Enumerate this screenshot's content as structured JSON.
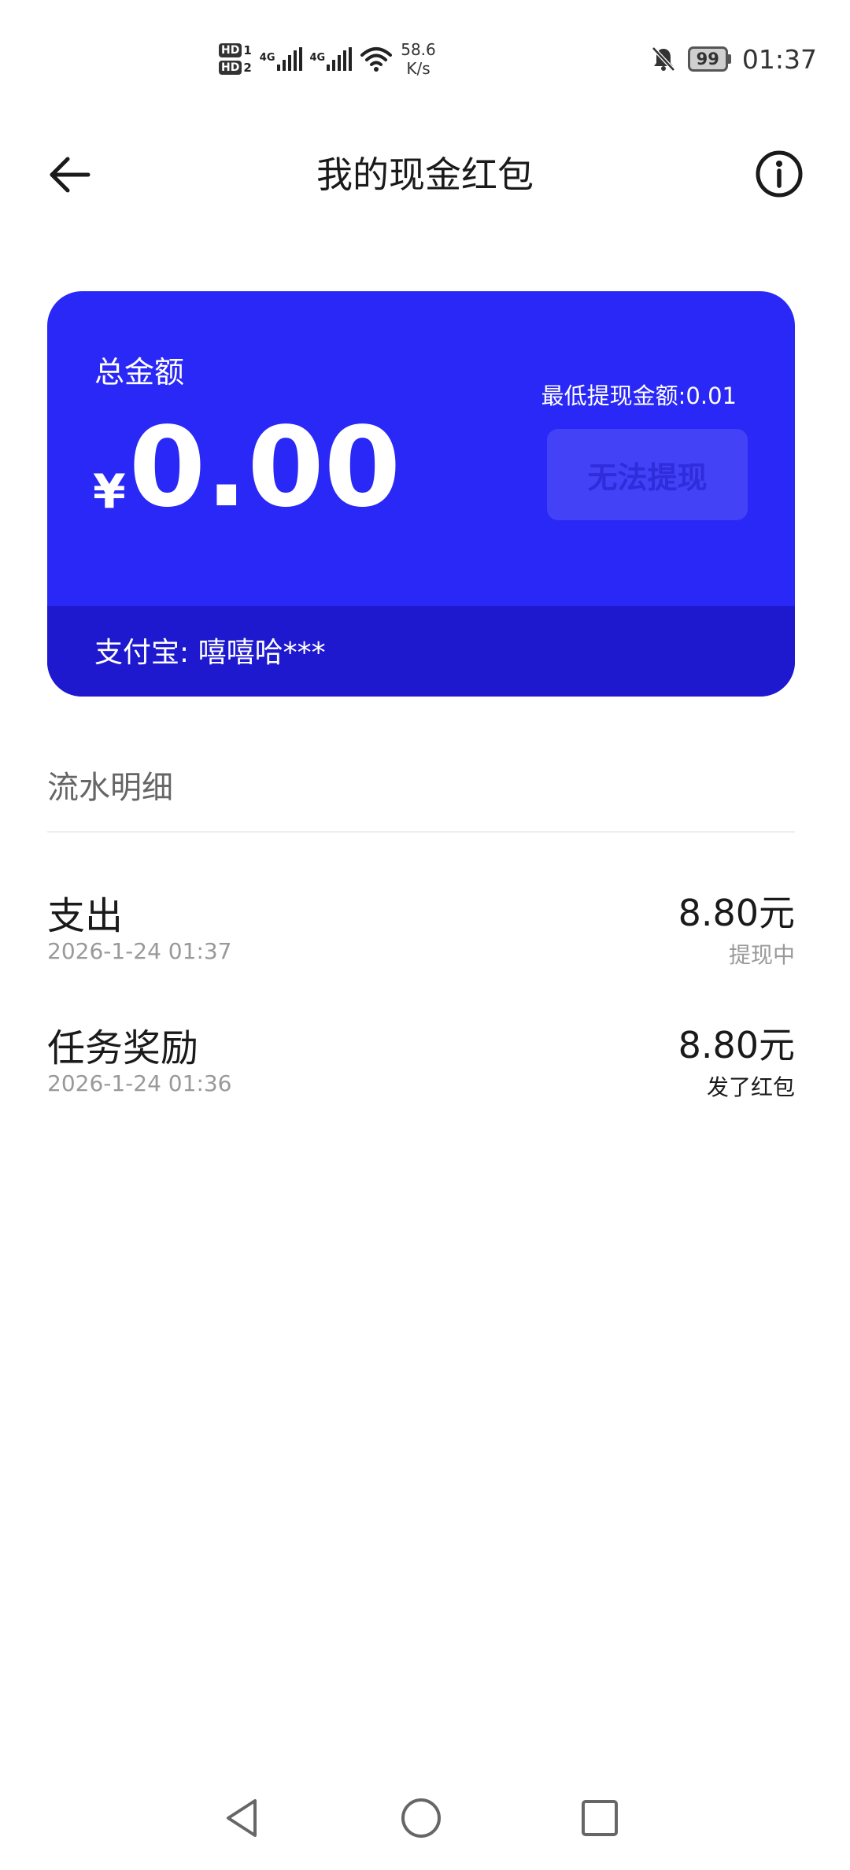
{
  "status_bar": {
    "sim1": "HD",
    "sim1_index": "1",
    "sim2": "HD",
    "sim2_index": "2",
    "net1": "4G",
    "net2": "4G",
    "speed_value": "58.6",
    "speed_unit": "K/s",
    "battery": "99",
    "time": "01:37",
    "icons": [
      "signal-icon",
      "wifi-icon",
      "mute-bell-icon",
      "battery-icon"
    ]
  },
  "header": {
    "title": "我的现金红包",
    "back_icon": "arrow-left-icon",
    "info_icon": "info-circle-icon"
  },
  "card": {
    "label": "总金额",
    "currency": "¥",
    "amount": "0.00",
    "min_withdraw": "最低提现金额:0.01",
    "withdraw_button": "无法提现",
    "account": "支付宝: 嘻嘻哈***",
    "colors": {
      "primary": "#2a28f6",
      "footer": "#1e18cf"
    }
  },
  "ledger": {
    "title": "流水明细",
    "items": [
      {
        "title": "支出",
        "date": "2026-1-24 01:37",
        "amount": "8.80元",
        "status": "提现中",
        "status_color": "#999999"
      },
      {
        "title": "任务奖励",
        "date": "2026-1-24 01:36",
        "amount": "8.80元",
        "status": "发了红包",
        "status_color": "#1a1a1a"
      }
    ]
  },
  "nav_bar": {
    "icons": [
      "back-triangle-icon",
      "home-circle-icon",
      "recents-square-icon"
    ]
  }
}
